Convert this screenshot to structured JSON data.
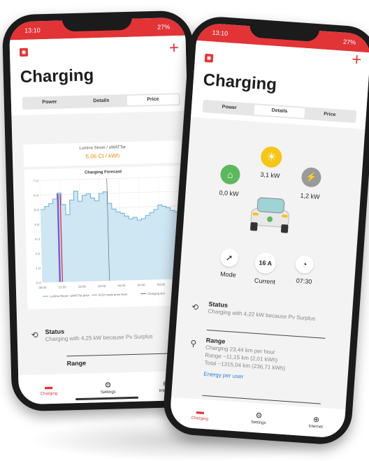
{
  "app": {
    "title": "Charging",
    "brand_color": "#e23436"
  },
  "phone_left": {
    "status": {
      "time": "13:10",
      "right": "27%"
    },
    "tabs": [
      {
        "label": "Power"
      },
      {
        "label": "Details"
      },
      {
        "label": "Price"
      }
    ],
    "price": {
      "provider": "Lumina Strom / aWATTar",
      "value": "5.06 Ct / kWh"
    },
    "chart_data": {
      "type": "line",
      "title": "Charging Forecast",
      "x_ticks": [
        "08:00",
        "12:00",
        "16:00",
        "20:00",
        "00:00",
        "04:00",
        "08:00",
        "12:00"
      ],
      "y_ticks": [
        "0 ct",
        "1 ct",
        "2 ct",
        "3 ct",
        "4 ct",
        "5 ct",
        "6 ct",
        "7 ct"
      ],
      "ylim": [
        0,
        7
      ],
      "series": [
        {
          "name": "Lumina Strom / aWATTar price",
          "color": "#6ab0d9",
          "values": [
            5.0,
            5.2,
            5.4,
            5.7,
            6.1,
            5.3,
            4.6,
            5.6,
            6.2,
            5.5,
            5.9,
            6.0,
            5.7,
            5.5,
            6.0,
            6.1,
            5.3,
            4.9,
            4.7,
            4.6,
            4.4,
            4.2,
            4.3,
            4.1,
            4.2,
            4.4,
            4.6,
            4.8,
            5.1,
            5.0,
            4.9,
            4.7,
            4.6
          ]
        },
        {
          "name": "ECO mode price level",
          "color": "#999999",
          "values": []
        },
        {
          "name": "Charging slot",
          "color": "#7a5cc8",
          "values": []
        }
      ],
      "legend": [
        "Lumina Strom / aWATTar price",
        "ECO mode price level",
        "Charging slot"
      ]
    },
    "status_block": {
      "label": "Status",
      "text": "Charging with 4,25 kW because Pv Surplus"
    },
    "range_label": "Range",
    "nav": [
      {
        "label": "Charging",
        "icon": "battery-icon"
      },
      {
        "label": "Settings",
        "icon": "gear-icon"
      },
      {
        "label": "Internet",
        "icon": "globe-icon"
      }
    ]
  },
  "phone_right": {
    "status": {
      "time": "13:10",
      "right": "27%"
    },
    "tabs": [
      {
        "label": "Power"
      },
      {
        "label": "Details"
      },
      {
        "label": "Price"
      }
    ],
    "flows": {
      "home": "0,0 kW",
      "sun": "3,1 kW",
      "grid": "1,2 kW"
    },
    "controls": {
      "mode_label": "Mode",
      "current_value": "16 A",
      "current_label": "Current",
      "time_value": "07:30"
    },
    "status_block": {
      "label": "Status",
      "text": "Charging with 4,22 kW because Pv Surplus"
    },
    "range": {
      "label": "Range",
      "line1": "Charging 23,44 km per hour",
      "line2": "Range ~11,15 km (2,01 kWh)",
      "line3": "Total ~1315,04 km (236,71 kWh)",
      "link": "Energy per user"
    },
    "nav": [
      {
        "label": "Charging",
        "icon": "battery-icon"
      },
      {
        "label": "Settings",
        "icon": "gear-icon"
      },
      {
        "label": "Internet",
        "icon": "globe-icon"
      }
    ]
  }
}
